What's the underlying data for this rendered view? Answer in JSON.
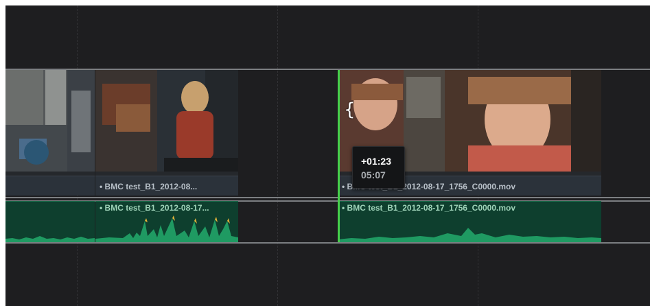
{
  "timeline": {
    "video_clips": [
      {
        "label": "",
        "name_visible": false
      },
      {
        "label": "• BMC test_B1_2012-08..."
      },
      {
        "label": "• BMC test_B1_2012-08-17_1756_C0000.mov",
        "selected": true
      }
    ],
    "audio_clips": [
      {
        "label": ""
      },
      {
        "label": "• BMC test_B1_2012-08-17..."
      },
      {
        "label": "• BMC test_B1_2012-08-17_1756_C0000.mov",
        "selected": true
      }
    ],
    "trim_tooltip": {
      "offset": "+01:23",
      "duration": "05:07"
    },
    "colors": {
      "background": "#1e1e20",
      "video_name_bar": "#2b323a",
      "audio_clip": "#0e3f2e",
      "waveform": "#1f9a62",
      "waveform_peak": "#e0b23a",
      "selection": "#46d04b"
    },
    "icons": {
      "trim_cursor": "trim-cursor-icon"
    }
  }
}
